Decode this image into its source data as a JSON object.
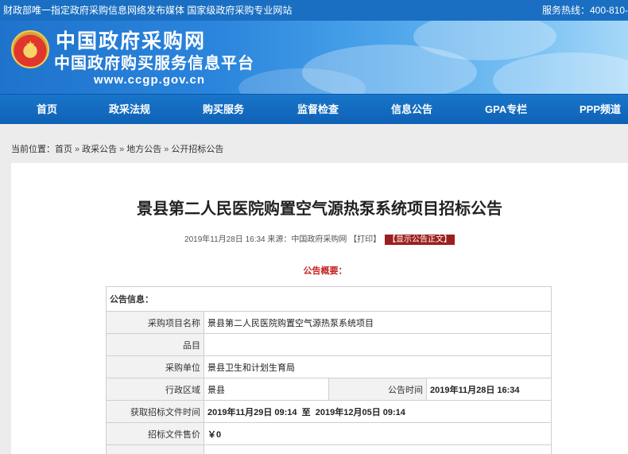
{
  "topbar": {
    "slogan": "财政部唯一指定政府采购信息网络发布媒体 国家级政府采购专业网站",
    "hotline": "服务热线：400-810-"
  },
  "header": {
    "brand_cn": "中国政府采购网",
    "brand_sub": "中国政府购买服务信息平台",
    "brand_url": "www.ccgp.gov.cn",
    "emblem_icon": "national-emblem-icon"
  },
  "nav": {
    "items": [
      "首页",
      "政采法规",
      "购买服务",
      "监督检查",
      "信息公告",
      "GPA专栏",
      "PPP频道"
    ]
  },
  "breadcrumb": {
    "prefix": "当前位置：",
    "items": [
      "首页",
      "政采公告",
      "地方公告",
      "公开招标公告"
    ],
    "separator": "»"
  },
  "article": {
    "title": "景县第二人民医院购置空气源热泵系统项目招标公告",
    "meta_date": "2019年11月28日 16:34",
    "meta_source": "来源：中国政府采购网",
    "meta_print": "【打印】",
    "meta_show_button": "【显示公告正文】",
    "summary_label": "公告概要：",
    "table": {
      "section_heading": "公告信息：",
      "rows": {
        "project_name_label": "采购项目名称",
        "project_name": "景县第二人民医院购置空气源热泵系统项目",
        "category_label": "品目",
        "category": "",
        "purchaser_label": "采购单位",
        "purchaser": "景县卫生和计划生育局",
        "region_label": "行政区域",
        "region": "景县",
        "publish_time_label": "公告时间",
        "publish_time": "2019年11月28日 16:34",
        "doc_time_label": "获取招标文件时间",
        "doc_time": "2019年11月29日 09:14  至  2019年12月05日 09:14",
        "doc_price_label": "招标文件售价",
        "doc_price": "￥0"
      }
    }
  },
  "colors": {
    "topbar": "#1a6fc3",
    "nav": "#1268bb",
    "accent_red": "#c5221f",
    "button_red": "#9c1f1f"
  }
}
